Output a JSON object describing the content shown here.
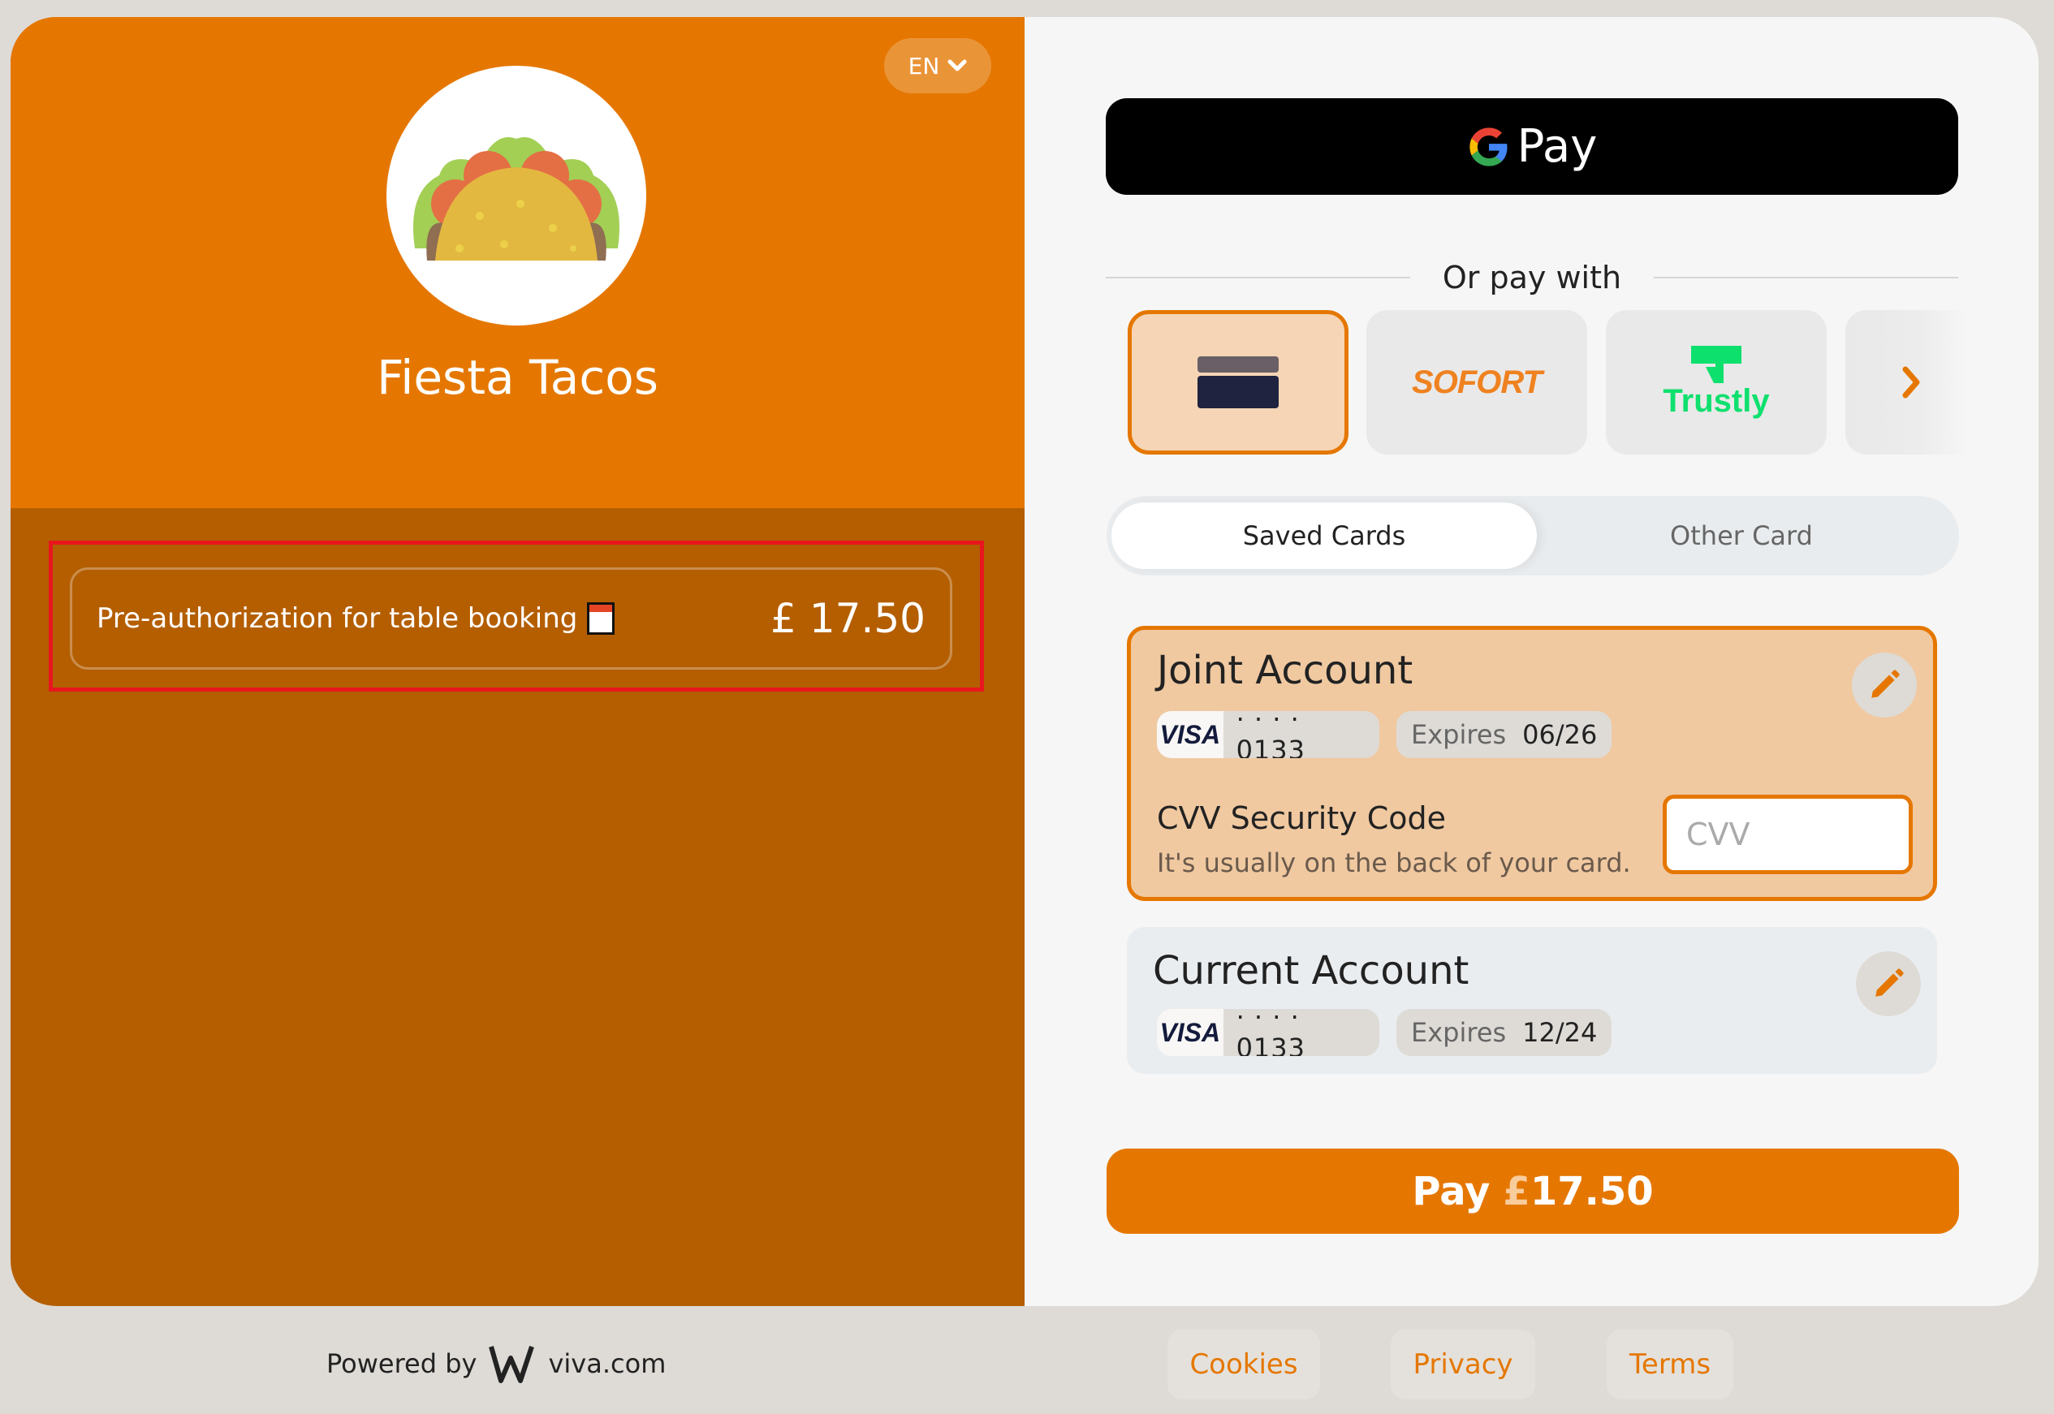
{
  "merchant": {
    "name": "Fiesta Tacos",
    "logo_icon": "taco-icon"
  },
  "language": {
    "selected": "EN",
    "icon": "chevron-down-icon"
  },
  "order": {
    "description": "Pre-authorization for table booking",
    "description_icon": "calendar-icon",
    "amount": "£ 17.50"
  },
  "express": {
    "gpay_label": "Pay",
    "gpay_icon": "google-g-icon"
  },
  "divider_text": "Or pay with",
  "payment_methods": [
    {
      "id": "card",
      "icon": "credit-card-icon",
      "label": "",
      "selected": true
    },
    {
      "id": "sofort",
      "icon": "sofort-logo",
      "label": "SOFORT",
      "selected": false
    },
    {
      "id": "trustly",
      "icon": "trustly-logo",
      "label": "Trustly",
      "selected": false
    },
    {
      "id": "more",
      "icon": "chevron-right-icon",
      "label": "",
      "selected": false
    }
  ],
  "tabs": [
    {
      "label": "Saved Cards",
      "active": true
    },
    {
      "label": "Other Card",
      "active": false
    }
  ],
  "saved_cards": [
    {
      "name": "Joint Account",
      "brand": "VISA",
      "masked": "· · · · 0133",
      "expires_label": "Expires",
      "expires": "06/26",
      "selected": true,
      "edit_icon": "pencil-icon"
    },
    {
      "name": "Current Account",
      "brand": "VISA",
      "masked": "· · · · 0133",
      "expires_label": "Expires",
      "expires": "12/24",
      "selected": false,
      "edit_icon": "pencil-icon"
    }
  ],
  "cvv": {
    "title": "CVV Security Code",
    "hint": "It's usually on the back of your card.",
    "placeholder": "CVV",
    "value": ""
  },
  "pay_button": {
    "label": "Pay",
    "currency": "£",
    "amount": "17.50"
  },
  "footer": {
    "powered_by": "Powered by",
    "brand": "viva.com",
    "links": [
      "Cookies",
      "Privacy",
      "Terms"
    ]
  },
  "colors": {
    "brand_orange": "#e57700",
    "dark_orange": "#b45e00",
    "selected_bg": "#f0c9a1",
    "highlight_red": "#e8161e",
    "trustly_green": "#0ee06e"
  }
}
